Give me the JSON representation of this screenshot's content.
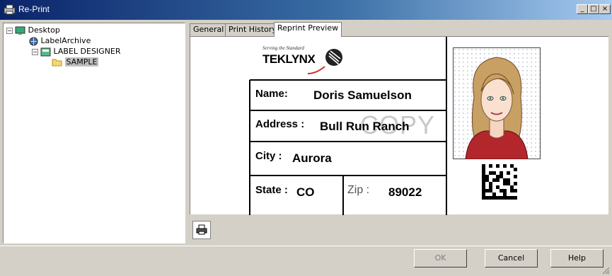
{
  "window": {
    "title": "Re-Print",
    "min_glyph": "_",
    "max_glyph": "□",
    "close_glyph": "×"
  },
  "tree": {
    "items": [
      {
        "label": "Desktop",
        "expander": "−"
      },
      {
        "label": "LabelArchive"
      },
      {
        "label": "LABEL DESIGNER",
        "expander": "−"
      },
      {
        "label": "SAMPLE"
      }
    ]
  },
  "tabs": [
    {
      "label": "General"
    },
    {
      "label": "Print History"
    },
    {
      "label": "Reprint Preview"
    }
  ],
  "label": {
    "logo_tagline": "Serving the Standard",
    "logo_text": "TEKLYNX",
    "watermark": "COPY",
    "name_label": "Name:",
    "name_value": "Doris Samuelson",
    "address_label": "Address :",
    "address_value": "Bull Run Ranch",
    "city_label": "City :",
    "city_value": "Aurora",
    "state_label": "State :",
    "state_value": "CO",
    "zip_label": "Zip :",
    "zip_value": "89022"
  },
  "buttons": {
    "ok": "OK",
    "cancel": "Cancel",
    "help": "Help"
  },
  "icons": {
    "app": "reprint-app-icon",
    "print": "printer-icon"
  }
}
